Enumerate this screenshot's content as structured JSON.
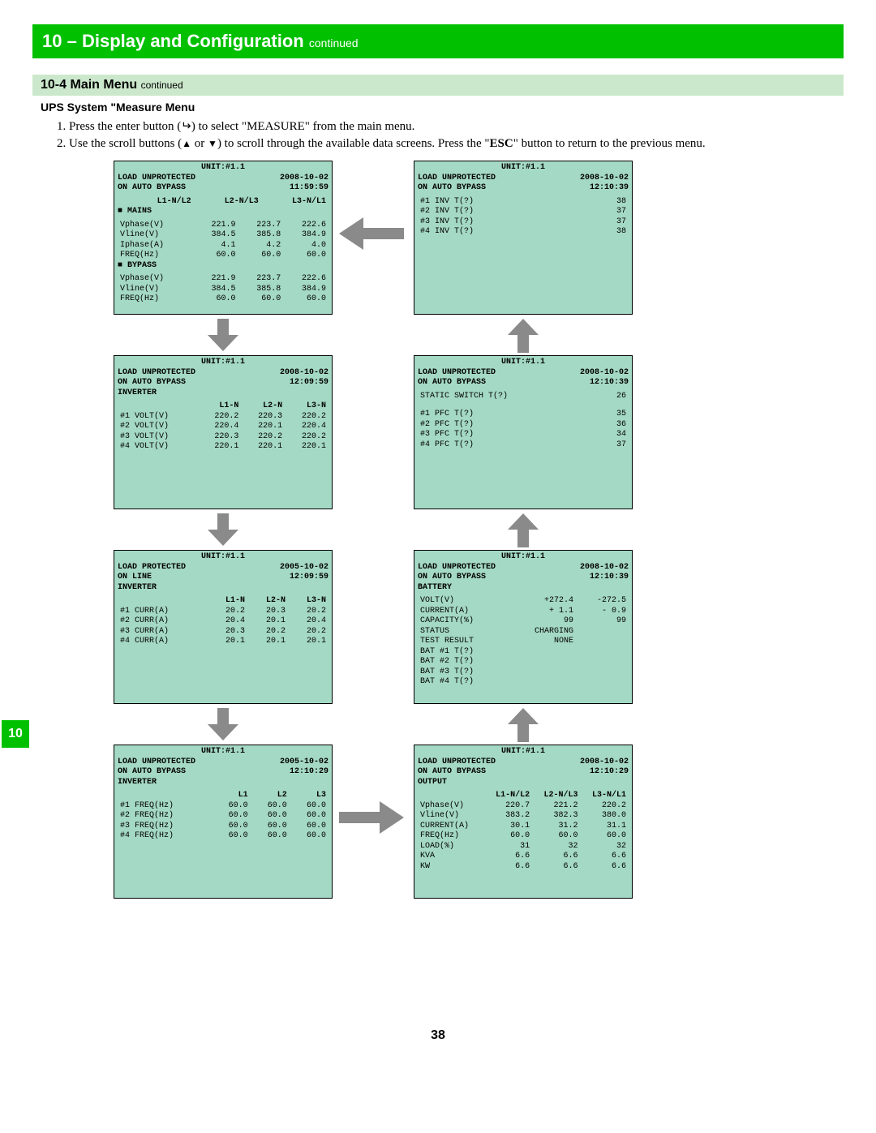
{
  "section": {
    "number": "10",
    "title": "Display and Configuration",
    "contd": "continued"
  },
  "subsection": {
    "number": "10-4",
    "title": "Main Menu",
    "contd": "continued"
  },
  "subsub_title": "UPS System \"Measure Menu",
  "steps": {
    "s1a": "1. Press the enter button (",
    "s1b": ") to select \"MEASURE\" from the main menu.",
    "s2a": "2. Use the scroll buttons (",
    "s2b": " or ",
    "s2c": ") to scroll through the available data screens. Press the \"",
    "s2d": "ESC",
    "s2e": "\" button to return to the previous menu."
  },
  "enter_glyph": "↵",
  "up_glyph": "▲",
  "dn_glyph": "▼",
  "side_tab": "10",
  "page_num": "38",
  "screens": {
    "A": {
      "unit": "UNIT:#1.1",
      "l1": "LOAD UNPROTECTED",
      "d1": "2008-10-02",
      "l2": "ON AUTO BYPASS",
      "d2": "11:59:59",
      "h": [
        "",
        "L1-N/L2",
        "L2-N/L3",
        "L3-N/L1"
      ],
      "grp1": "■ MAINS",
      "rows1": [
        [
          "Vphase(V)",
          "221.9",
          "223.7",
          "222.6"
        ],
        [
          "Vline(V)",
          "384.5",
          "385.8",
          "384.9"
        ],
        [
          "Iphase(A)",
          "4.1",
          "4.2",
          "4.0"
        ],
        [
          "FREQ(Hz)",
          "60.0",
          "60.0",
          "60.0"
        ]
      ],
      "grp2": "■ BYPASS",
      "rows2": [
        [
          "Vphase(V)",
          "221.9",
          "223.7",
          "222.6"
        ],
        [
          "Vline(V)",
          "384.5",
          "385.8",
          "384.9"
        ],
        [
          "FREQ(Hz)",
          "60.0",
          "60.0",
          "60.0"
        ]
      ]
    },
    "B": {
      "unit": "UNIT:#1.1",
      "l1": "LOAD UNPROTECTED",
      "d1": "2008-10-02",
      "l2": "ON AUTO BYPASS",
      "d2": "12:09:59",
      "title": "INVERTER",
      "h": [
        "",
        "L1-N",
        "L2-N",
        "L3-N"
      ],
      "rows": [
        [
          "#1 VOLT(V)",
          "220.2",
          "220.3",
          "220.2"
        ],
        [
          "#2 VOLT(V)",
          "220.4",
          "220.1",
          "220.4"
        ],
        [
          "#3 VOLT(V)",
          "220.3",
          "220.2",
          "220.2"
        ],
        [
          "#4 VOLT(V)",
          "220.1",
          "220.1",
          "220.1"
        ]
      ]
    },
    "C": {
      "unit": "UNIT:#1.1",
      "l1": "LOAD PROTECTED",
      "d1": "2005-10-02",
      "l2": "ON LINE",
      "d2": "12:09:59",
      "title": "INVERTER",
      "h": [
        "",
        "L1-N",
        "L2-N",
        "L3-N"
      ],
      "rows": [
        [
          "#1 CURR(A)",
          "20.2",
          "20.3",
          "20.2"
        ],
        [
          "#2 CURR(A)",
          "20.4",
          "20.1",
          "20.4"
        ],
        [
          "#3 CURR(A)",
          "20.3",
          "20.2",
          "20.2"
        ],
        [
          "#4 CURR(A)",
          "20.1",
          "20.1",
          "20.1"
        ]
      ]
    },
    "D": {
      "unit": "UNIT:#1.1",
      "l1": "LOAD UNPROTECTED",
      "d1": "2005-10-02",
      "l2": "ON AUTO BYPASS",
      "d2": "12:10:29",
      "title": "INVERTER",
      "h": [
        "",
        "L1",
        "L2",
        "L3"
      ],
      "rows": [
        [
          "#1 FREQ(Hz)",
          "60.0",
          "60.0",
          "60.0"
        ],
        [
          "#2 FREQ(Hz)",
          "60.0",
          "60.0",
          "60.0"
        ],
        [
          "#3 FREQ(Hz)",
          "60.0",
          "60.0",
          "60.0"
        ],
        [
          "#4 FREQ(Hz)",
          "60.0",
          "60.0",
          "60.0"
        ]
      ]
    },
    "E": {
      "unit": "UNIT:#1.1",
      "l1": "LOAD UNPROTECTED",
      "d1": "2008-10-02",
      "l2": "ON AUTO BYPASS",
      "d2": "12:10:39",
      "rows": [
        [
          "#1 INV T(?)",
          "38"
        ],
        [
          "#2 INV T(?)",
          "37"
        ],
        [
          "#3 INV T(?)",
          "37"
        ],
        [
          "#4 INV T(?)",
          "38"
        ]
      ]
    },
    "F": {
      "unit": "UNIT:#1.1",
      "l1": "LOAD UNPROTECTED",
      "d1": "2008-10-02",
      "l2": "ON AUTO BYPASS",
      "d2": "12:10:39",
      "t1": [
        "STATIC SWITCH T(?)",
        "26"
      ],
      "rows": [
        [
          "#1 PFC T(?)",
          "35"
        ],
        [
          "#2 PFC T(?)",
          "36"
        ],
        [
          "#3 PFC T(?)",
          "34"
        ],
        [
          "#4 PFC T(?)",
          "37"
        ]
      ]
    },
    "G": {
      "unit": "UNIT:#1.1",
      "l1": "LOAD UNPROTECTED",
      "d1": "2008-10-02",
      "l2": "ON AUTO BYPASS",
      "d2": "12:10:39",
      "title": "BATTERY",
      "rows_kv": [
        [
          "VOLT(V)",
          "+272.4",
          "-272.5"
        ],
        [
          "CURRENT(A)",
          "+ 1.1",
          "- 0.9"
        ],
        [
          "CAPACITY(%)",
          "99",
          "99"
        ],
        [
          "STATUS",
          "CHARGING",
          ""
        ],
        [
          "TEST RESULT",
          "NONE",
          ""
        ],
        [
          "BAT #1 T(?)",
          "",
          ""
        ],
        [
          "BAT #2 T(?)",
          "",
          ""
        ],
        [
          "BAT #3 T(?)",
          "",
          ""
        ],
        [
          "BAT #4 T(?)",
          "",
          ""
        ]
      ]
    },
    "H": {
      "unit": "UNIT:#1.1",
      "l1": "LOAD UNPROTECTED",
      "d1": "2008-10-02",
      "l2": "ON AUTO BYPASS",
      "d2": "12:10:29",
      "title": "OUTPUT",
      "h": [
        "",
        "L1-N/L2",
        "L2-N/L3",
        "L3-N/L1"
      ],
      "rows": [
        [
          "Vphase(V)",
          "220.7",
          "221.2",
          "220.2"
        ],
        [
          "Vline(V)",
          "383.2",
          "382.3",
          "380.0"
        ],
        [
          "CURRENT(A)",
          "30.1",
          "31.2",
          "31.1"
        ],
        [
          "FREQ(Hz)",
          "60.0",
          "60.0",
          "60.0"
        ],
        [
          "LOAD(%)",
          "31",
          "32",
          "32"
        ],
        [
          "KVA",
          "6.6",
          "6.6",
          "6.6"
        ],
        [
          "KW",
          "6.6",
          "6.6",
          "6.6"
        ]
      ]
    }
  }
}
